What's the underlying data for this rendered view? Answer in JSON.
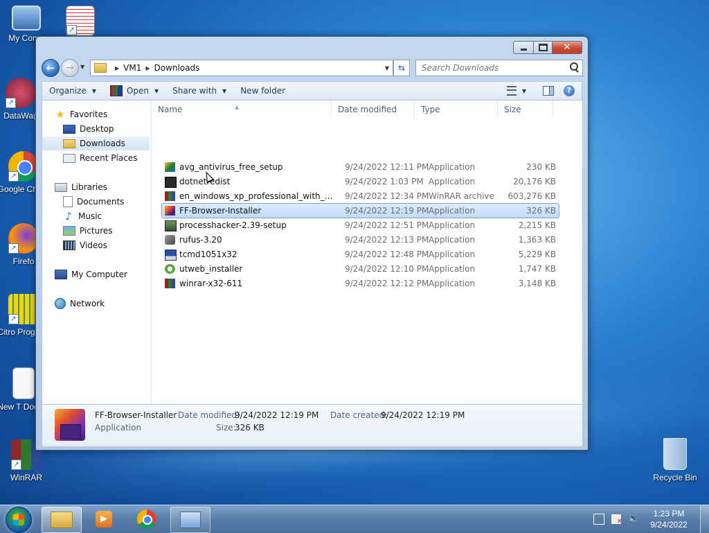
{
  "desktop_icons": [
    {
      "label": "My Comp",
      "icon": "computer-icon"
    },
    {
      "label": "",
      "icon": "document-icon"
    },
    {
      "label": "DataWag",
      "icon": "datawag-icon"
    },
    {
      "label": "Google Chron",
      "icon": "chrome-icon"
    },
    {
      "label": "Firefo",
      "icon": "firefox-icon"
    },
    {
      "label": "Citro Program",
      "icon": "citro-icon"
    },
    {
      "label": "New T Docum",
      "icon": "text-doc-icon"
    },
    {
      "label": "WinRAR",
      "icon": "winrar-icon"
    },
    {
      "label": "Recycle Bin",
      "icon": "recycle-bin-icon"
    }
  ],
  "window": {
    "address": {
      "crumbs": [
        "VM1",
        "Downloads"
      ]
    },
    "search_placeholder": "Search Downloads",
    "toolbar": {
      "organize": "Organize",
      "open": "Open",
      "share_with": "Share with",
      "new_folder": "New folder"
    },
    "nav": {
      "favorites": "Favorites",
      "desktop": "Desktop",
      "downloads": "Downloads",
      "recent_places": "Recent Places",
      "libraries": "Libraries",
      "documents": "Documents",
      "music": "Music",
      "pictures": "Pictures",
      "videos": "Videos",
      "my_computer": "My Computer",
      "network": "Network",
      "selected": "Downloads"
    },
    "columns": {
      "name": "Name",
      "date_modified": "Date modified",
      "type": "Type",
      "size": "Size"
    },
    "files": [
      {
        "name": "avg_antivirus_free_setup",
        "date": "9/24/2022 12:11 PM",
        "type": "Application",
        "size": "230 KB",
        "icon": "avg-icon"
      },
      {
        "name": "dotnetredist",
        "date": "9/24/2022 1:03 PM",
        "type": "Application",
        "size": "20,176 KB",
        "icon": "setup-icon"
      },
      {
        "name": "en_windows_xp_professional_with_servic...",
        "date": "9/24/2022 12:34 PM",
        "type": "WinRAR archive",
        "size": "603,276 KB",
        "icon": "winrar-archive-icon"
      },
      {
        "name": "FF-Browser-Installer",
        "date": "9/24/2022 12:19 PM",
        "type": "Application",
        "size": "326 KB",
        "icon": "firefox-installer-icon",
        "selected": true
      },
      {
        "name": "processhacker-2.39-setup",
        "date": "9/24/2022 12:51 PM",
        "type": "Application",
        "size": "2,215 KB",
        "icon": "processhacker-icon"
      },
      {
        "name": "rufus-3.20",
        "date": "9/24/2022 12:13 PM",
        "type": "Application",
        "size": "1,363 KB",
        "icon": "rufus-icon"
      },
      {
        "name": "tcmd1051x32",
        "date": "9/24/2022 12:48 PM",
        "type": "Application",
        "size": "5,229 KB",
        "icon": "floppy-icon"
      },
      {
        "name": "utweb_installer",
        "date": "9/24/2022 12:10 PM",
        "type": "Application",
        "size": "1,747 KB",
        "icon": "utorrent-icon"
      },
      {
        "name": "winrar-x32-611",
        "date": "9/24/2022 12:12 PM",
        "type": "Application",
        "size": "3,148 KB",
        "icon": "winrar-icon"
      }
    ],
    "details": {
      "name": "FF-Browser-Installer",
      "type": "Application",
      "date_modified_label": "Date modified:",
      "date_modified": "9/24/2022 12:19 PM",
      "date_created_label": "Date created:",
      "date_created": "9/24/2022 12:19 PM",
      "size_label": "Size:",
      "size": "326 KB"
    }
  },
  "taskbar": {
    "clock_time": "1:23 PM",
    "clock_date": "9/24/2022",
    "pinned": [
      "explorer-icon",
      "media-player-icon",
      "chrome-icon",
      "control-panel-icon"
    ]
  }
}
